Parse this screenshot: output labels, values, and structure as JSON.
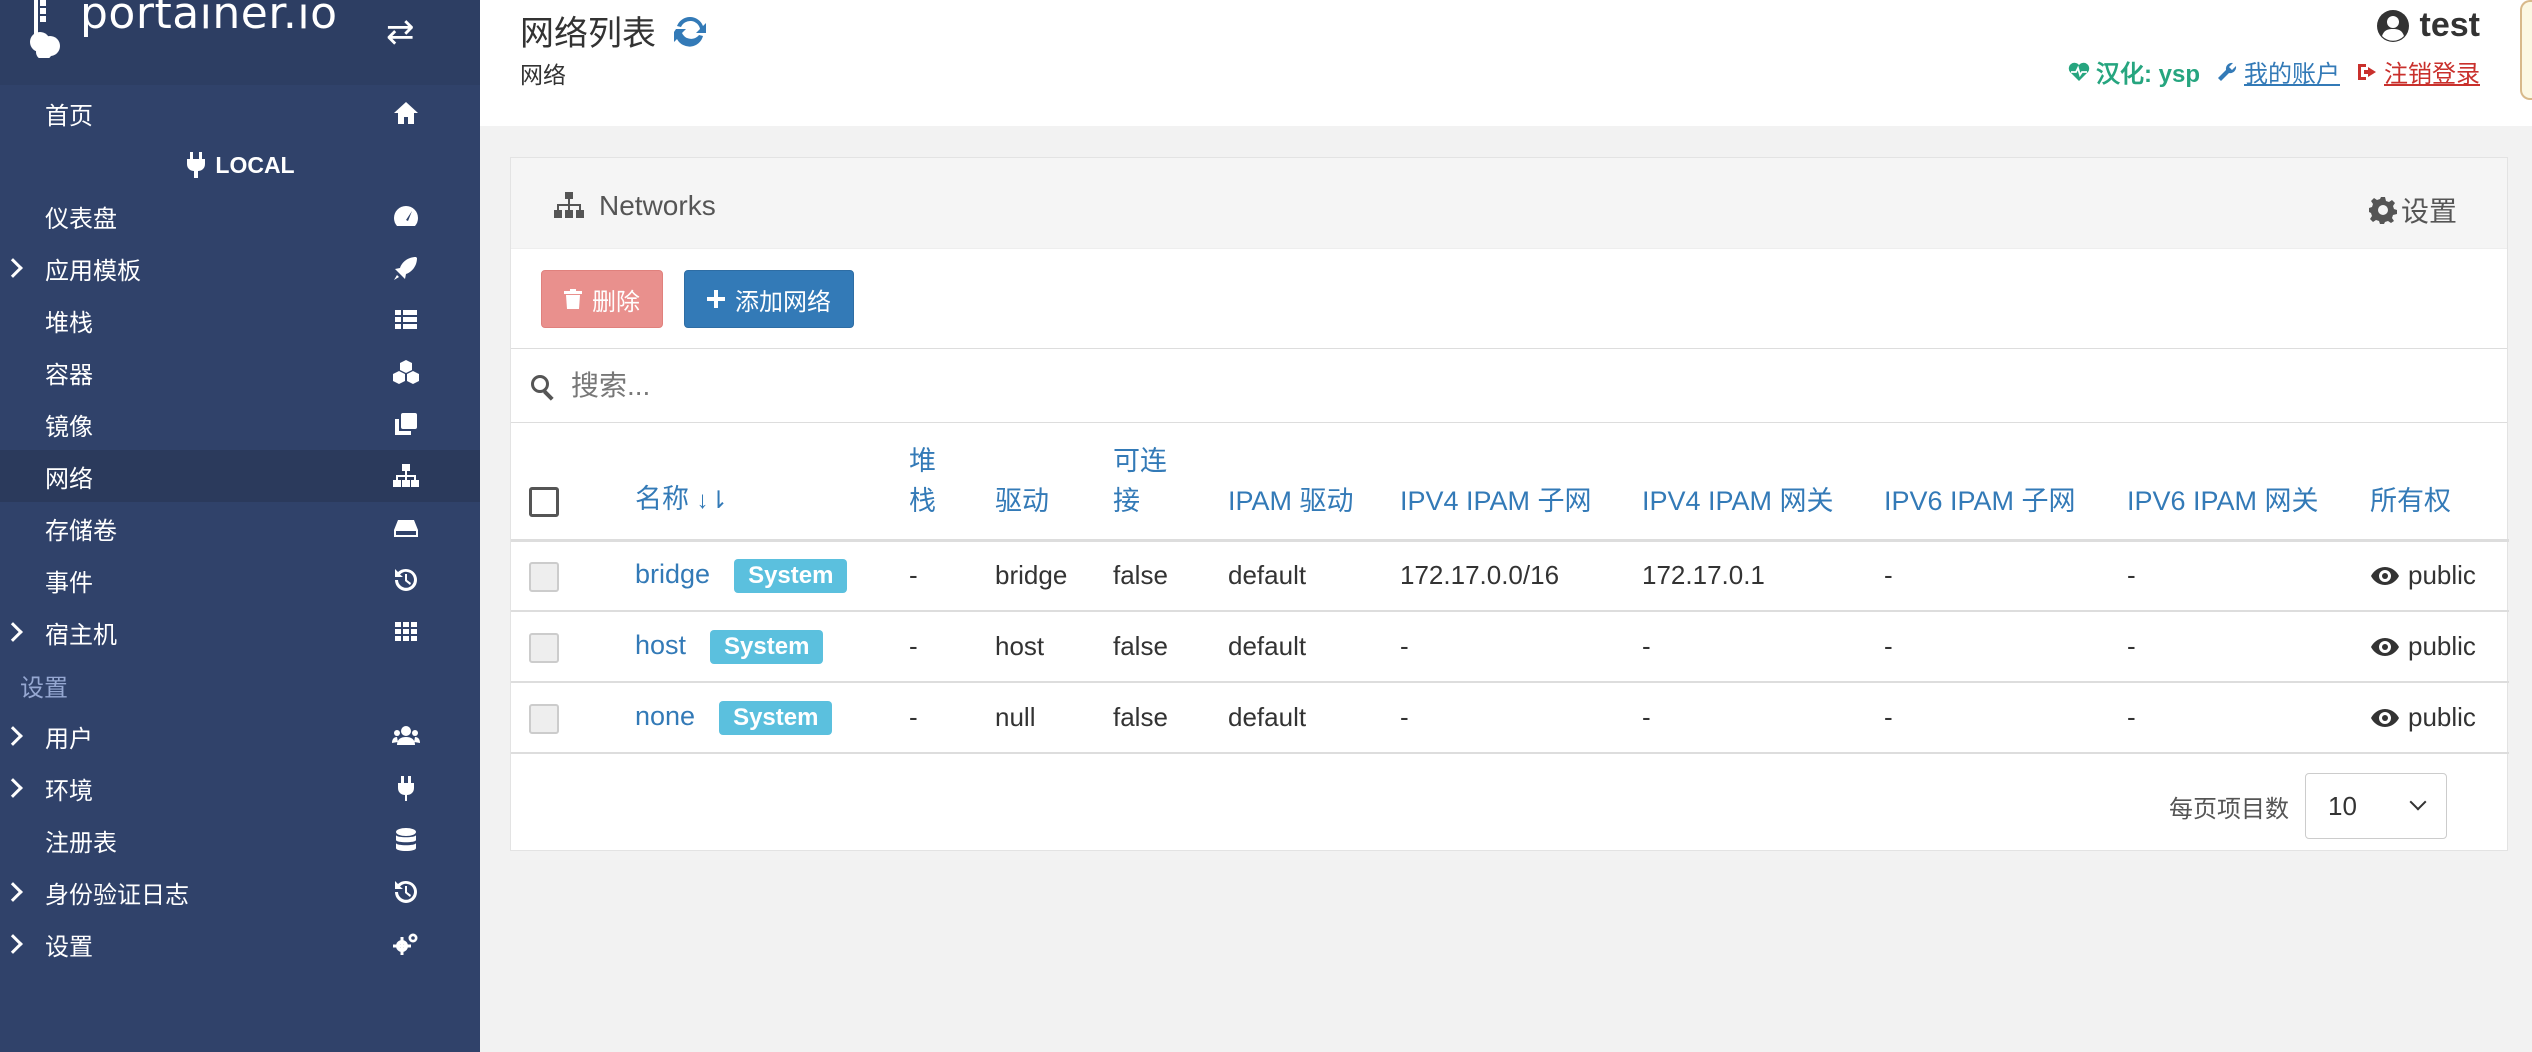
{
  "brand": {
    "logo_text": "portainer.io"
  },
  "sidebar": {
    "endpoint": "LOCAL",
    "section_settings": "设置",
    "items": [
      {
        "label": "首页"
      },
      {
        "label": "仪表盘"
      },
      {
        "label": "应用模板"
      },
      {
        "label": "堆栈"
      },
      {
        "label": "容器"
      },
      {
        "label": "镜像"
      },
      {
        "label": "网络"
      },
      {
        "label": "存储卷"
      },
      {
        "label": "事件"
      },
      {
        "label": "宿主机"
      },
      {
        "label": "用户"
      },
      {
        "label": "环境"
      },
      {
        "label": "注册表"
      },
      {
        "label": "身份验证日志"
      },
      {
        "label": "设置"
      }
    ]
  },
  "header": {
    "title": "网络列表",
    "breadcrumb": "网络",
    "user": "test",
    "ysp": "汉化: ysp",
    "account": "我的账户",
    "logout": "注销登录"
  },
  "widget": {
    "title": "Networks",
    "settings": "设置",
    "delete_label": "删除",
    "add_label": "添加网络",
    "search_placeholder": "搜索..."
  },
  "table": {
    "headers": {
      "name": "名称",
      "stack": "堆栈",
      "driver": "驱动",
      "attachable": "可连接",
      "ipam_driver": "IPAM 驱动",
      "ipv4_subnet": "IPV4 IPAM 子网",
      "ipv4_gateway": "IPV4 IPAM 网关",
      "ipv6_subnet": "IPV6 IPAM 子网",
      "ipv6_gateway": "IPV6 IPAM 网关",
      "ownership": "所有权"
    },
    "rows": [
      {
        "name": "bridge",
        "badge": "System",
        "stack": "-",
        "driver": "bridge",
        "attachable": "false",
        "ipam_driver": "default",
        "ipv4_subnet": "172.17.0.0/16",
        "ipv4_gateway": "172.17.0.1",
        "ipv6_subnet": "-",
        "ipv6_gateway": "-",
        "ownership": "public"
      },
      {
        "name": "host",
        "badge": "System",
        "stack": "-",
        "driver": "host",
        "attachable": "false",
        "ipam_driver": "default",
        "ipv4_subnet": "-",
        "ipv4_gateway": "-",
        "ipv6_subnet": "-",
        "ipv6_gateway": "-",
        "ownership": "public"
      },
      {
        "name": "none",
        "badge": "System",
        "stack": "-",
        "driver": "null",
        "attachable": "false",
        "ipam_driver": "default",
        "ipv4_subnet": "-",
        "ipv4_gateway": "-",
        "ipv6_subnet": "-",
        "ipv6_gateway": "-",
        "ownership": "public"
      }
    ]
  },
  "pagination": {
    "label": "每页项目数",
    "value": "10"
  }
}
